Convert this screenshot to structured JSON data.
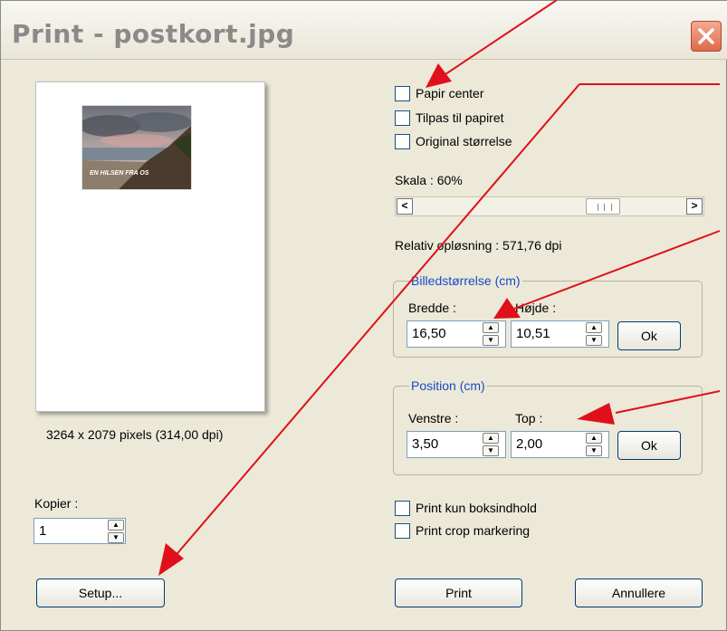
{
  "window": {
    "title": "Print - postkort.jpg",
    "close_icon": "close-icon"
  },
  "preview": {
    "photo_caption": "EN HILSEN FRA OS",
    "pixel_info": "3264 x 2079 pixels (314,00 dpi)"
  },
  "copies": {
    "label": "Kopier :",
    "value": "1"
  },
  "buttons": {
    "setup": "Setup...",
    "print": "Print",
    "cancel": "Annullere"
  },
  "options": {
    "paper_center": "Papir center",
    "fit_to_paper": "Tilpas til papiret",
    "original_size": "Original størrelse",
    "print_box_content": "Print kun boksindhold",
    "print_crop_marks": "Print crop markering"
  },
  "scale": {
    "label": "Skala : 60%",
    "left_arrow": "<",
    "right_arrow": ">"
  },
  "resolution": {
    "label": "Relativ opløsning : 571,76 dpi"
  },
  "image_size": {
    "legend": "Billedstørrelse (cm)",
    "width_label": "Bredde :",
    "height_label": "Højde :",
    "width_value": "16,50",
    "height_value": "10,51",
    "ok": "Ok"
  },
  "position": {
    "legend": "Position (cm)",
    "left_label": "Venstre :",
    "top_label": "Top :",
    "left_value": "3,50",
    "top_value": "2,00",
    "ok": "Ok"
  },
  "colors": {
    "annotation_arrow": "#e0101a",
    "legend_text": "#1849c7"
  }
}
